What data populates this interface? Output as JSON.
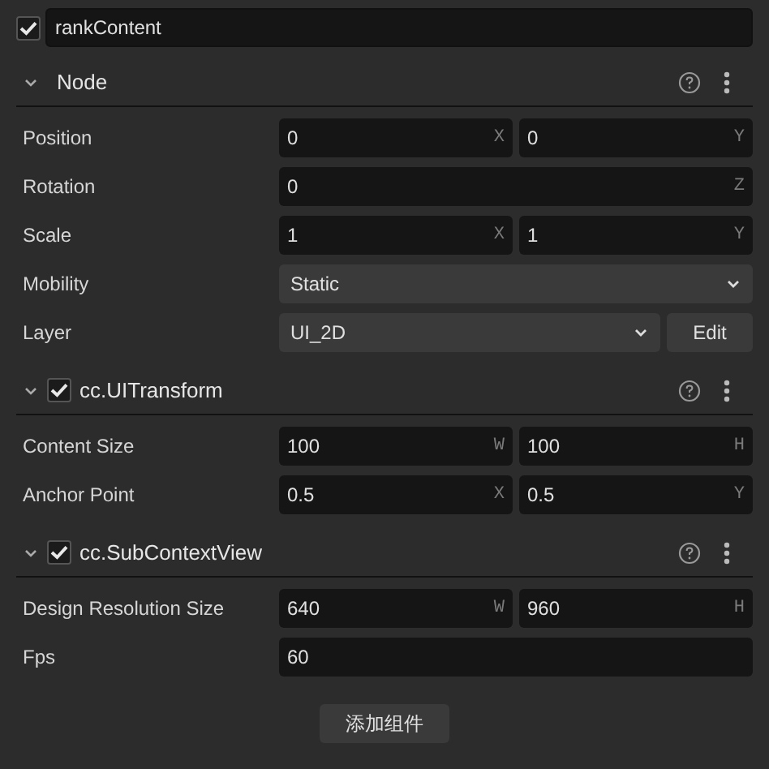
{
  "node": {
    "enabled": true,
    "name": "rankContent"
  },
  "sections": [
    {
      "kind": "node",
      "title": "Node",
      "expanded": true,
      "properties": [
        {
          "label": "Position",
          "kind": "vector",
          "fields": [
            {
              "value": "0",
              "axis": "X"
            },
            {
              "value": "0",
              "axis": "Y"
            }
          ]
        },
        {
          "label": "Rotation",
          "kind": "vector",
          "fields": [
            {
              "value": "0",
              "axis": "Z"
            }
          ]
        },
        {
          "label": "Scale",
          "kind": "vector",
          "fields": [
            {
              "value": "1",
              "axis": "X"
            },
            {
              "value": "1",
              "axis": "Y"
            }
          ]
        },
        {
          "label": "Mobility",
          "kind": "select",
          "value": "Static"
        },
        {
          "label": "Layer",
          "kind": "select",
          "value": "UI_2D",
          "button": "Edit"
        }
      ]
    },
    {
      "kind": "component",
      "title": "cc.UITransform",
      "enabled": true,
      "expanded": true,
      "properties": [
        {
          "label": "Content Size",
          "kind": "vector",
          "fields": [
            {
              "value": "100",
              "axis": "W"
            },
            {
              "value": "100",
              "axis": "H"
            }
          ]
        },
        {
          "label": "Anchor Point",
          "kind": "vector",
          "fields": [
            {
              "value": "0.5",
              "axis": "X"
            },
            {
              "value": "0.5",
              "axis": "Y"
            }
          ]
        }
      ]
    },
    {
      "kind": "component",
      "title": "cc.SubContextView",
      "enabled": true,
      "expanded": true,
      "properties": [
        {
          "label": "Design Resolution Size",
          "kind": "vector",
          "fields": [
            {
              "value": "640",
              "axis": "W"
            },
            {
              "value": "960",
              "axis": "H"
            }
          ]
        },
        {
          "label": "Fps",
          "kind": "vector",
          "fields": [
            {
              "value": "60"
            }
          ]
        }
      ]
    }
  ],
  "add_button": "添加组件"
}
